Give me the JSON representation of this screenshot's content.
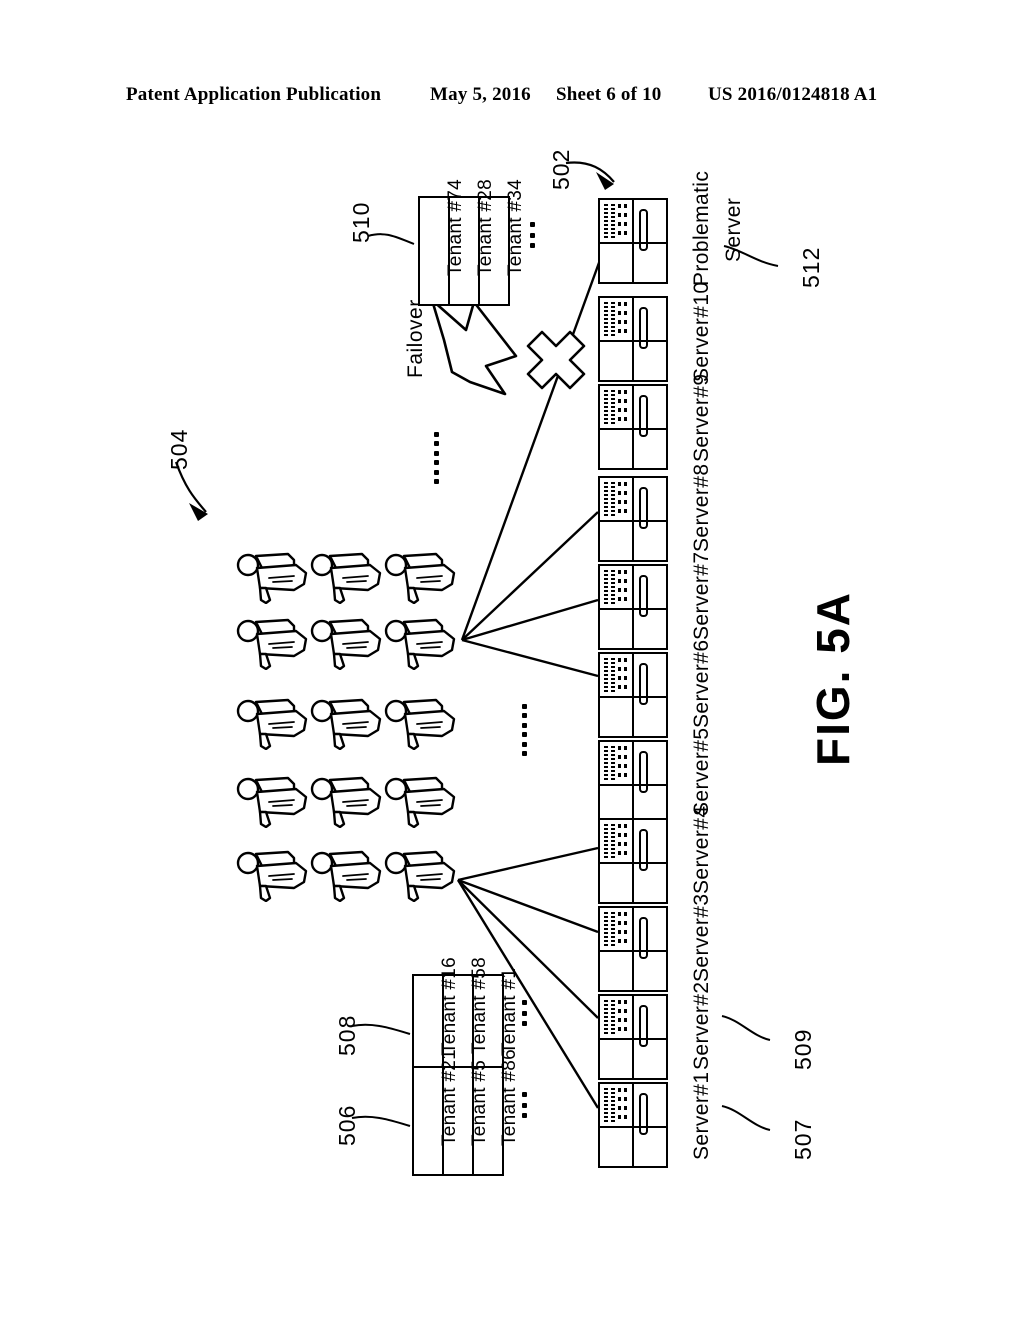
{
  "header": {
    "publication": "Patent Application Publication",
    "date": "May 5, 2016",
    "sheet": "Sheet 6 of 10",
    "docnumber": "US 2016/0124818 A1"
  },
  "figure": {
    "label": "FIG. 5A",
    "failover_label": "Failover",
    "refs": {
      "r502": "502",
      "r504": "504",
      "r506": "506",
      "r507": "507",
      "r508": "508",
      "r509": "509",
      "r510": "510",
      "r512": "512"
    },
    "ellipsis": "· · ·",
    "tenant_groups": [
      {
        "id": "506",
        "tenants": [
          "Tenant #21",
          "Tenant #5",
          "Tenant #86"
        ]
      },
      {
        "id": "508",
        "tenants": [
          "Tenant #16",
          "Tenant #58",
          "Tenant #1"
        ]
      },
      {
        "id": "510",
        "tenants": [
          "Tenant #74",
          "Tenant #28",
          "Tenant #34"
        ]
      }
    ],
    "servers": [
      {
        "id": "server-1",
        "label": "Server#1"
      },
      {
        "id": "server-2",
        "label": "Server#2"
      },
      {
        "id": "server-3",
        "label": "Server#3"
      },
      {
        "id": "server-4",
        "label": "Server#4"
      },
      {
        "id": "server-5",
        "label": "Server#5"
      },
      {
        "id": "server-6",
        "label": "Server#6"
      },
      {
        "id": "server-7",
        "label": "Server#7"
      },
      {
        "id": "server-8",
        "label": "Server#8"
      },
      {
        "id": "server-9",
        "label": "Server#9"
      },
      {
        "id": "server-10",
        "label": "Server#10"
      },
      {
        "id": "problematic-server",
        "label": "Problematic\nServer"
      }
    ],
    "problematic_server_label_line1": "Problematic",
    "problematic_server_label_line2": "Server",
    "user_count": 15
  }
}
